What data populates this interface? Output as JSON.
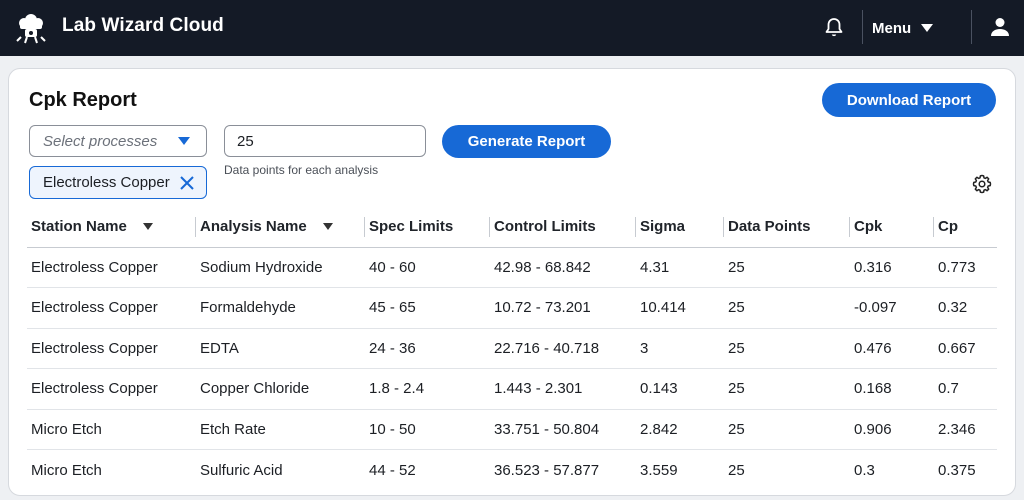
{
  "app": {
    "title": "Lab Wizard Cloud"
  },
  "header": {
    "menu_label": "Menu"
  },
  "page": {
    "title": "Cpk Report",
    "download_label": "Download Report"
  },
  "controls": {
    "process_placeholder": "Select processes",
    "selected_chip": "Electroless Copper",
    "points_value": "25",
    "points_helper": "Data points for each analysis",
    "generate_label": "Generate Report"
  },
  "table": {
    "headers": [
      "Station Name",
      "Analysis Name",
      "Spec Limits",
      "Control Limits",
      "Sigma",
      "Data Points",
      "Cpk",
      "Cp"
    ],
    "rows": [
      [
        "Electroless Copper",
        "Sodium Hydroxide",
        "40 - 60",
        "42.98 - 68.842",
        "4.31",
        "25",
        "0.316",
        "0.773"
      ],
      [
        "Electroless Copper",
        "Formaldehyde",
        "45 - 65",
        "10.72 - 73.201",
        "10.414",
        "25",
        "-0.097",
        "0.32"
      ],
      [
        "Electroless Copper",
        "EDTA",
        "24 - 36",
        "22.716 - 40.718",
        "3",
        "25",
        "0.476",
        "0.667"
      ],
      [
        "Electroless Copper",
        "Copper Chloride",
        "1.8 - 2.4",
        "1.443 - 2.301",
        "0.143",
        "25",
        "0.168",
        "0.7"
      ],
      [
        "Micro Etch",
        "Etch Rate",
        "10 - 50",
        "33.751 - 50.804",
        "2.842",
        "25",
        "0.906",
        "2.346"
      ],
      [
        "Micro Etch",
        "Sulfuric Acid",
        "44 - 52",
        "36.523 - 57.877",
        "3.559",
        "25",
        "0.3",
        "0.375"
      ]
    ]
  },
  "icons": {
    "logo": "lab-wizard-logo-icon",
    "bell": "bell-icon",
    "menu_caret": "caret-down-icon",
    "user": "user-icon",
    "chip_remove": "close-icon",
    "settings": "gear-icon",
    "sort": "sort-caret-icon"
  },
  "colors": {
    "topbar": "#141a26",
    "accent": "#1769d6",
    "chip_bg": "#eef4fd"
  }
}
